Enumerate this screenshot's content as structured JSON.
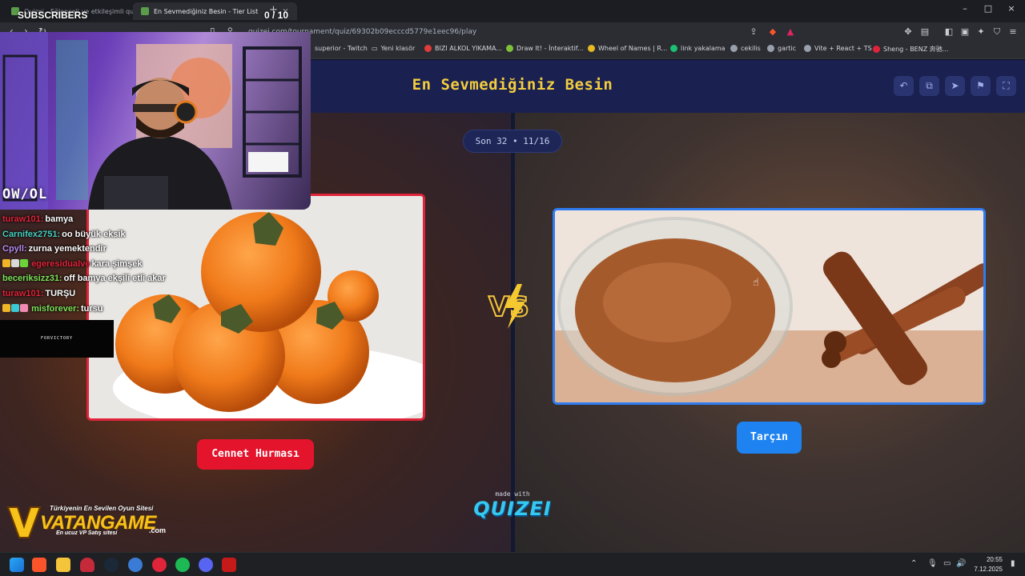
{
  "browser": {
    "tabs": [
      {
        "label": "Quizei - Eğlenceli ve etkileşimli quizle"
      },
      {
        "label": "En Sevmediğiniz Besin - Tier List"
      }
    ],
    "url": "quizei.com/tournament/quiz/69302b09ecccd5779e1eec96/play",
    "bookmarks": [
      "superior - Twitch",
      "Yeni klasör",
      "BIZI ALKOL YIKAMA...",
      "Draw It! - İnteraktif...",
      "Wheel of Names | R...",
      "link yakalama",
      "cekilis",
      "gartic",
      "Vite + React + TS",
      "Sheng - BENZ 奔驰..."
    ]
  },
  "quiz": {
    "title": "En Sevmediğiniz Besin",
    "round": "Son 32 • 11/16",
    "left_choice": "Cennet Hurması",
    "right_choice": "Tarçın",
    "made_with": "made with",
    "brand": "QUIZEI"
  },
  "overlay": {
    "subscribers_label": "SUBSCRIBERS",
    "subscribers_count": "0 / 10",
    "channel_logo": "OW/OL",
    "sponsor_box": "FORVICTORY",
    "chat": [
      {
        "user": "turaw101:",
        "msg": "bamya",
        "color": "#e0243a"
      },
      {
        "user": "Carnifex2751:",
        "msg": "oo büyük eksik",
        "color": "#45d0c0"
      },
      {
        "user": "Cpyll:",
        "msg": "zurna yemektendir",
        "color": "#b78cf0"
      },
      {
        "user": "egeresidualve",
        "msg": "kara şimşek",
        "color": "#e0243a"
      },
      {
        "user": "beceriksizz31:",
        "msg": "off bamya ekşili etli akar",
        "color": "#7de05a"
      },
      {
        "user": "turaw101:",
        "msg": "TURŞU",
        "color": "#e0243a"
      },
      {
        "user": "misforever:",
        "msg": "tursu",
        "color": "#7de05a"
      }
    ],
    "vatan": {
      "tagline": "Türkiyenin En Sevilen Oyun Sitesi",
      "name": "VATANGAME",
      "dotcom": ".com",
      "sub": "En ucuz VP Satış sitesi"
    }
  },
  "taskbar": {
    "time": "20:55",
    "date": "7.12.2025"
  },
  "colors": {
    "title_yellow": "#f3cd3f",
    "left_red": "#e3142c",
    "right_blue": "#1e83f0"
  }
}
